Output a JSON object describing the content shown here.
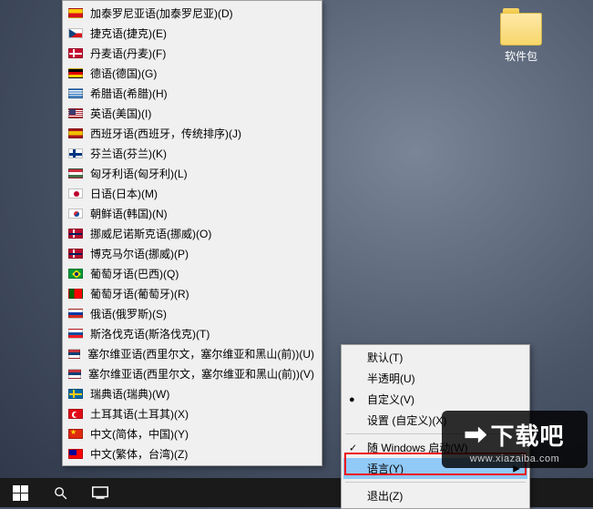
{
  "desktop": {
    "icon_label": "软件包"
  },
  "languages": [
    {
      "flag": "esy",
      "label": "加泰罗尼亚语(加泰罗尼亚)(D)"
    },
    {
      "flag": "cz",
      "label": "捷克语(捷克)(E)"
    },
    {
      "flag": "dk",
      "label": "丹麦语(丹麦)(F)"
    },
    {
      "flag": "de",
      "label": "德语(德国)(G)"
    },
    {
      "flag": "gr",
      "label": "希腊语(希腊)(H)"
    },
    {
      "flag": "us",
      "label": "英语(美国)(I)"
    },
    {
      "flag": "es",
      "label": "西班牙语(西班牙，传统排序)(J)"
    },
    {
      "flag": "fi",
      "label": "芬兰语(芬兰)(K)"
    },
    {
      "flag": "hu",
      "label": "匈牙利语(匈牙利)(L)"
    },
    {
      "flag": "jp",
      "label": "日语(日本)(M)"
    },
    {
      "flag": "kr",
      "label": "朝鲜语(韩国)(N)"
    },
    {
      "flag": "no",
      "label": "挪威尼诺斯克语(挪威)(O)"
    },
    {
      "flag": "no",
      "label": "博克马尔语(挪威)(P)"
    },
    {
      "flag": "br",
      "label": "葡萄牙语(巴西)(Q)"
    },
    {
      "flag": "pt",
      "label": "葡萄牙语(葡萄牙)(R)"
    },
    {
      "flag": "ru",
      "label": "俄语(俄罗斯)(S)"
    },
    {
      "flag": "sk",
      "label": "斯洛伐克语(斯洛伐克)(T)"
    },
    {
      "flag": "rs",
      "label": "塞尔维亚语(西里尔文，塞尔维亚和黑山(前))(U)"
    },
    {
      "flag": "rs",
      "label": "塞尔维亚语(西里尔文，塞尔维亚和黑山(前))(V)"
    },
    {
      "flag": "se",
      "label": "瑞典语(瑞典)(W)"
    },
    {
      "flag": "tr",
      "label": "土耳其语(土耳其)(X)"
    },
    {
      "flag": "cn",
      "label": "中文(简体，中国)(Y)"
    },
    {
      "flag": "tw",
      "label": "中文(繁体，台湾)(Z)"
    }
  ],
  "tray_menu": {
    "default": "默认(T)",
    "translucent": "半透明(U)",
    "custom": "自定义(V)",
    "settings": "设置 (自定义)(X)",
    "startup": "随 Windows 启动(W)",
    "language": "语言(Y)",
    "exit": "退出(Z)",
    "custom_mark": "●",
    "startup_mark": "✓",
    "submenu_arrow": "▶"
  },
  "watermark": {
    "title": "下载吧",
    "url": "www.xiazaiba.com"
  }
}
